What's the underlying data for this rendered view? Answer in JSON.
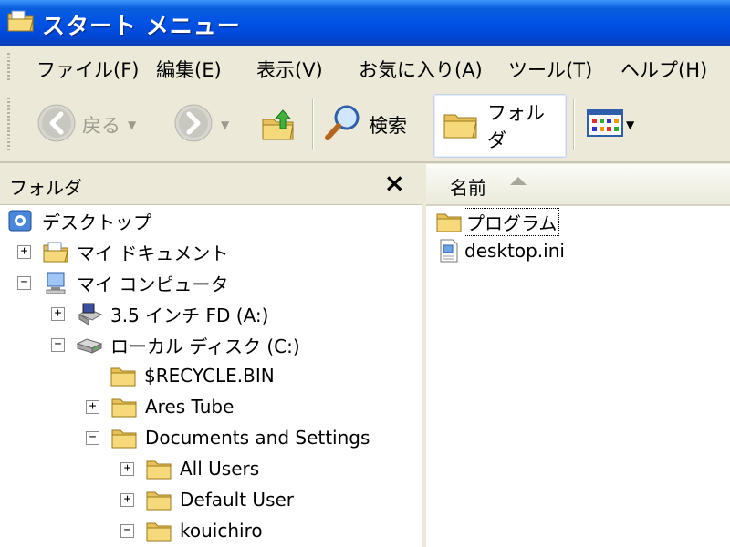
{
  "window": {
    "title": "スタート メニュー"
  },
  "menubar": {
    "items": [
      "ファイル(F)",
      "編集(E)",
      "表示(V)",
      "お気に入り(A)",
      "ツール(T)",
      "ヘルプ(H)"
    ]
  },
  "toolbar": {
    "back_label": "戻る",
    "search_label": "検索",
    "folders_label": "フォルダ"
  },
  "folders_pane": {
    "title": "フォルダ",
    "close_glyph": "×",
    "tree": [
      {
        "label": "デスクトップ",
        "expander": "",
        "icon": "desktop-icon"
      },
      {
        "label": "マイ ドキュメント",
        "expander": "+",
        "icon": "my-documents-icon"
      },
      {
        "label": "マイ コンピュータ",
        "expander": "−",
        "icon": "my-computer-icon"
      },
      {
        "label": "3.5 インチ FD (A:)",
        "expander": "+",
        "icon": "floppy-drive-icon"
      },
      {
        "label": "ローカル ディスク (C:)",
        "expander": "−",
        "icon": "hard-disk-icon"
      },
      {
        "label": "$RECYCLE.BIN",
        "expander": "",
        "icon": "folder-icon"
      },
      {
        "label": "Ares Tube",
        "expander": "+",
        "icon": "folder-icon"
      },
      {
        "label": "Documents and Settings",
        "expander": "−",
        "icon": "folder-icon"
      },
      {
        "label": "All Users",
        "expander": "+",
        "icon": "folder-icon"
      },
      {
        "label": "Default User",
        "expander": "+",
        "icon": "folder-icon"
      },
      {
        "label": "kouichiro",
        "expander": "−",
        "icon": "folder-icon"
      }
    ]
  },
  "file_list": {
    "column_name": "名前",
    "items": [
      {
        "name": "プログラム",
        "icon": "folder-icon"
      },
      {
        "name": "desktop.ini",
        "icon": "settings-file-icon"
      }
    ]
  },
  "colors": {
    "titlebar": "#0052e6",
    "chrome": "#ece9d8",
    "folder": "#f5d36b"
  }
}
